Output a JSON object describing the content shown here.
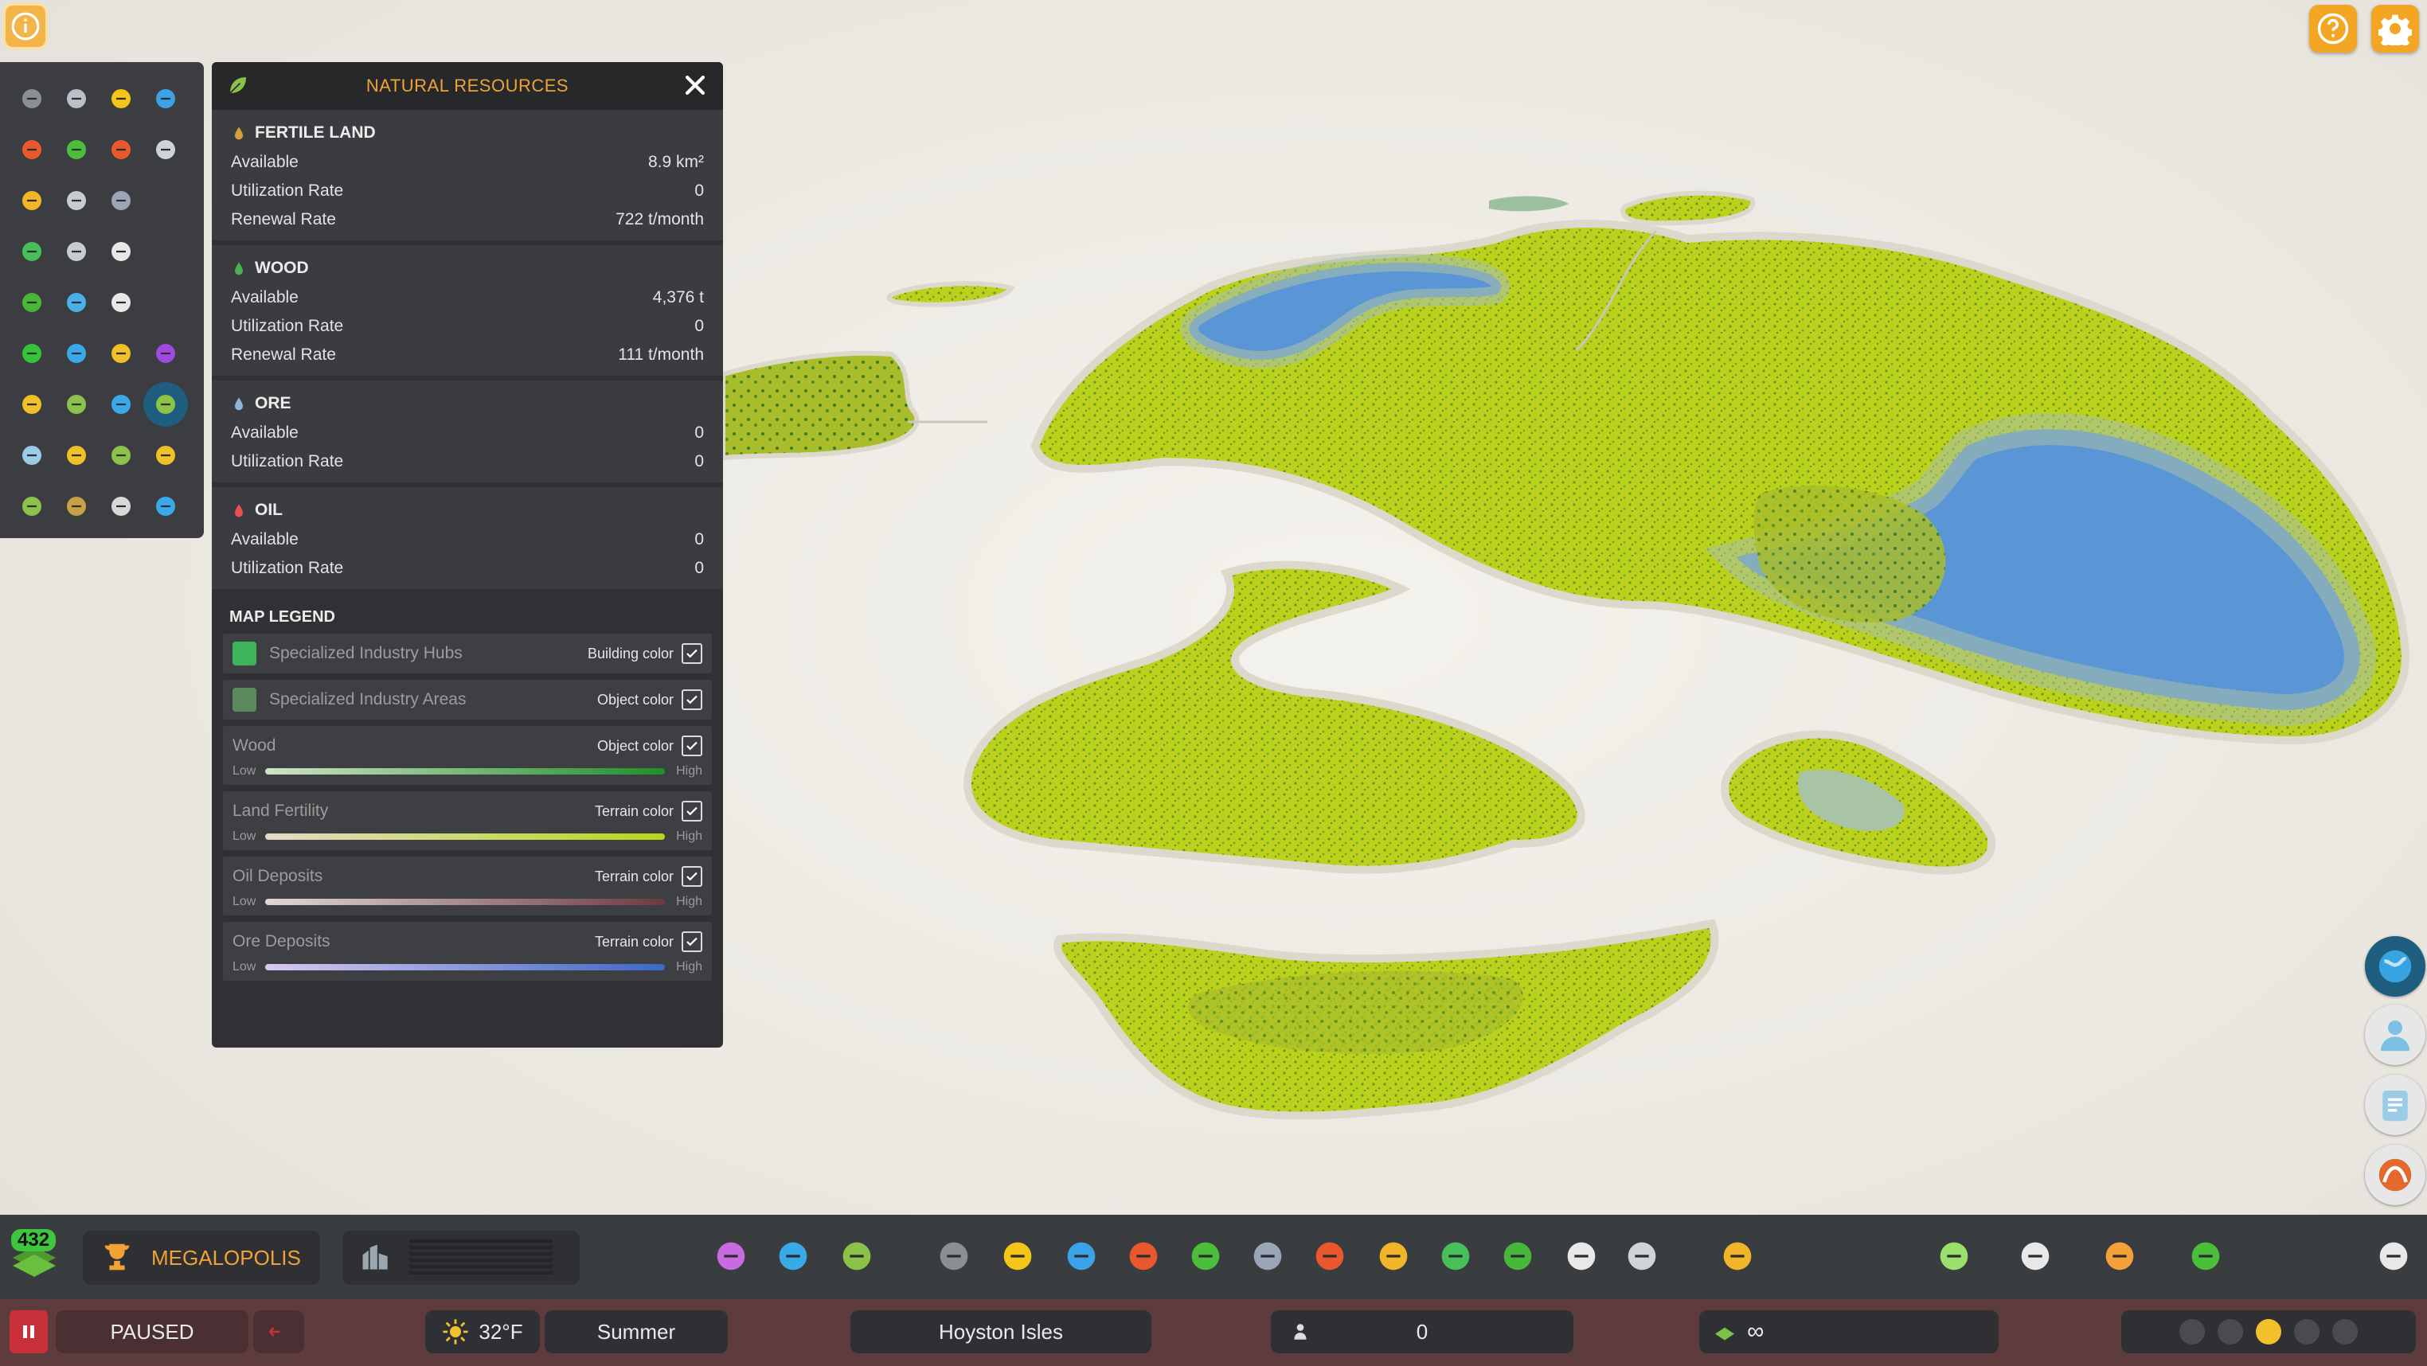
{
  "panel": {
    "title": "NATURAL RESOURCES",
    "sections": [
      {
        "name": "FERTILE LAND",
        "icon": "wheat-icon",
        "rows": [
          {
            "label": "Available",
            "value": "8.9 km²"
          },
          {
            "label": "Utilization Rate",
            "value": "0"
          },
          {
            "label": "Renewal Rate",
            "value": "722 t/month"
          }
        ]
      },
      {
        "name": "WOOD",
        "icon": "tree-icon",
        "rows": [
          {
            "label": "Available",
            "value": "4,376 t"
          },
          {
            "label": "Utilization Rate",
            "value": "0"
          },
          {
            "label": "Renewal Rate",
            "value": "111 t/month"
          }
        ]
      },
      {
        "name": "ORE",
        "icon": "ore-icon",
        "rows": [
          {
            "label": "Available",
            "value": "0"
          },
          {
            "label": "Utilization Rate",
            "value": "0"
          }
        ]
      },
      {
        "name": "OIL",
        "icon": "oil-drop-icon",
        "rows": [
          {
            "label": "Available",
            "value": "0"
          },
          {
            "label": "Utilization Rate",
            "value": "0"
          }
        ]
      }
    ],
    "legend_title": "MAP LEGEND",
    "legend": [
      {
        "name": "Specialized Industry Hubs",
        "kind": "Building color",
        "checked": true,
        "swatch": "#3db35a"
      },
      {
        "name": "Specialized Industry Areas",
        "kind": "Object color",
        "checked": true,
        "swatch": "#5a8a5e"
      },
      {
        "name": "Wood",
        "kind": "Object color",
        "checked": true,
        "low": "Low",
        "high": "High",
        "gradient": [
          "#cfe3c4",
          "#1f8f2a"
        ]
      },
      {
        "name": "Land Fertility",
        "kind": "Terrain color",
        "checked": true,
        "low": "Low",
        "high": "High",
        "gradient": [
          "#e2dcc8",
          "#b9d61a"
        ]
      },
      {
        "name": "Oil Deposits",
        "kind": "Terrain color",
        "checked": true,
        "low": "Low",
        "high": "High",
        "gradient": [
          "#e0d8d6",
          "#6e3a40"
        ]
      },
      {
        "name": "Ore Deposits",
        "kind": "Terrain color",
        "checked": true,
        "low": "Low",
        "high": "High",
        "gradient": [
          "#d8c8f0",
          "#3c68c8"
        ]
      }
    ]
  },
  "palette_icons": [
    [
      "road-icon",
      "bus-road-icon",
      "electricity-icon",
      "water-icon"
    ],
    [
      "healthcare-icon",
      "recycle-icon",
      "fire-station-icon",
      "tools-icon"
    ],
    [
      "police-icon",
      "government-icon",
      "education-icon"
    ],
    [
      "transport-icon",
      "mail-icon",
      "chat-icon"
    ],
    [
      "parks-icon",
      "luggage-icon",
      "arrow-icon"
    ],
    [
      "residential-zone-icon",
      "commercial-zone-icon",
      "industrial-zone-icon",
      "office-zone-icon"
    ],
    [
      "house-icon",
      "zoning-icon",
      "graph-icon",
      "natural-resources-icon"
    ],
    [
      "population-icon",
      "happiness-icon",
      "money-icon",
      "workers-icon"
    ],
    [
      "terrain-icon",
      "crate-icon",
      "headphones-icon",
      "water-map-icon"
    ]
  ],
  "milestone": {
    "level": "432",
    "name": "MEGALOPOLIS"
  },
  "status": {
    "paused": "PAUSED",
    "temperature": "32°F",
    "season": "Summer",
    "city_name": "Hoyston Isles",
    "population": "0",
    "money": "∞"
  },
  "colors": {
    "accent": "#f0a236",
    "panel_bg": "#2f3134",
    "toolbar_bg": "#3a3d40",
    "status_bg": "#5e3c3e"
  }
}
